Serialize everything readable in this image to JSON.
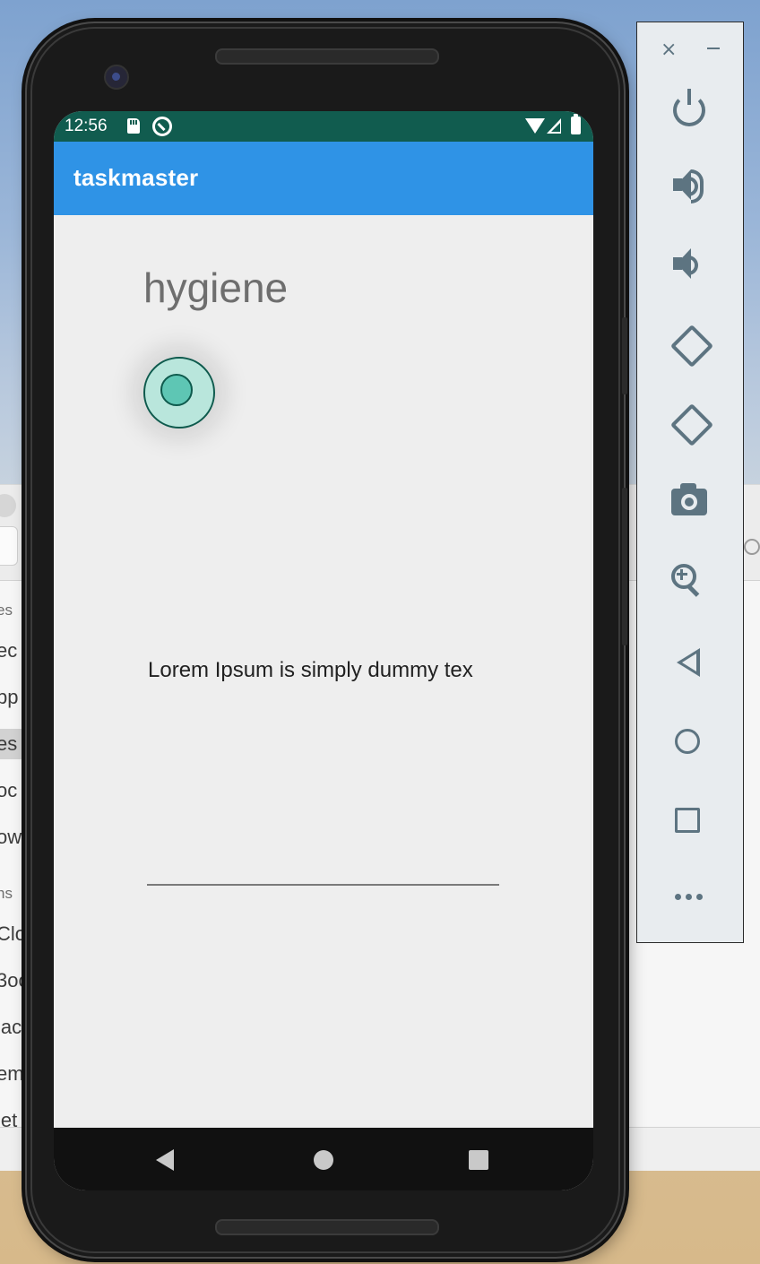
{
  "background_window": {
    "sidebar_items": [
      {
        "text": "es",
        "kind": "heading"
      },
      {
        "text": "ec",
        "kind": "item"
      },
      {
        "text": "pp",
        "kind": "item"
      },
      {
        "text": "es",
        "kind": "item",
        "selected": true
      },
      {
        "text": "oc",
        "kind": "item"
      },
      {
        "text": "ow",
        "kind": "item"
      },
      {
        "text": "ns",
        "kind": "heading"
      },
      {
        "text": "Clo",
        "kind": "item"
      },
      {
        "text": "3oc",
        "kind": "item"
      },
      {
        "text": "lac",
        "kind": "item"
      },
      {
        "text": "em",
        "kind": "item"
      },
      {
        "text": "let",
        "kind": "item"
      }
    ]
  },
  "phone": {
    "status_bar": {
      "time": "12:56",
      "icons": [
        "sd-card-icon",
        "sync-icon",
        "wifi-icon",
        "signal-icon",
        "battery-icon"
      ],
      "color": "#115c4f"
    },
    "app_bar": {
      "title": "taskmaster",
      "color": "#2f93e6"
    },
    "content": {
      "task_title": "hygiene",
      "radio_selected": true,
      "description": "Lorem Ipsum is simply dummy tex",
      "input_value": ""
    },
    "nav_bar": {
      "buttons": [
        "back-icon",
        "home-icon",
        "recents-icon"
      ]
    }
  },
  "emulator_toolbar": {
    "window_controls": [
      "close-icon",
      "minimize-icon"
    ],
    "close_glyph": "×",
    "buttons": [
      "power-icon",
      "volume-up-icon",
      "volume-down-icon",
      "rotate-left-icon",
      "rotate-right-icon",
      "screenshot-icon",
      "zoom-icon",
      "back-icon",
      "home-icon",
      "overview-icon",
      "more-icon"
    ],
    "icon_color": "#5d7481"
  }
}
